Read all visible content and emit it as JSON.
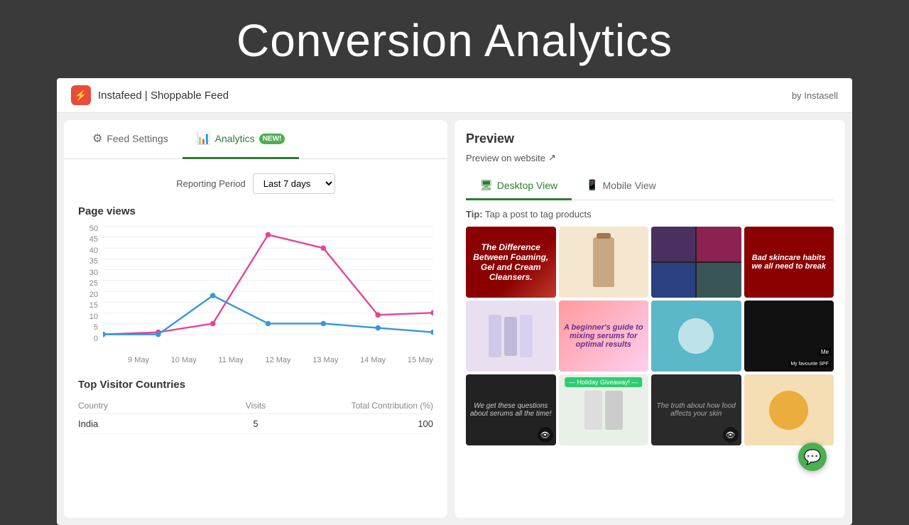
{
  "page": {
    "title": "Conversion Analytics",
    "app_name": "Instafeed | Shoppable Feed",
    "by": "by Instasell"
  },
  "tabs": [
    {
      "id": "feed-settings",
      "label": "Feed Settings",
      "icon": "⚙",
      "active": false
    },
    {
      "id": "analytics",
      "label": "Analytics",
      "icon": "📊",
      "active": true,
      "badge": "NEW!"
    }
  ],
  "reporting": {
    "label": "Reporting Period",
    "period": "Last 7 days"
  },
  "chart": {
    "title": "Page views",
    "y_labels": [
      "50",
      "45",
      "40",
      "35",
      "30",
      "25",
      "20",
      "15",
      "10",
      "5",
      "0"
    ],
    "x_labels": [
      "9 May",
      "10 May",
      "11 May",
      "12 May",
      "13 May",
      "14 May",
      "15 May"
    ],
    "pink_data": [
      0,
      1,
      5,
      46,
      40,
      9,
      10
    ],
    "blue_data": [
      0,
      0,
      18,
      5,
      5,
      3,
      1
    ]
  },
  "visitors": {
    "title": "Top Visitor Countries",
    "columns": [
      "Country",
      "Visits",
      "Total Contribution (%)"
    ],
    "rows": [
      {
        "country": "India",
        "visits": "5",
        "contribution": "100"
      }
    ]
  },
  "preview": {
    "title": "Preview",
    "link_label": "Preview on website",
    "tip": "Tip: Tap a post to tag products",
    "view_tabs": [
      {
        "id": "desktop",
        "label": "Desktop View",
        "icon": "🖥",
        "active": true
      },
      {
        "id": "mobile",
        "label": "Mobile View",
        "icon": "📱",
        "active": false
      }
    ]
  },
  "grid_items": [
    {
      "id": 1,
      "text": "The Difference Between Foaming, Gel and Cream Cleansers.",
      "type": "text-dark-red"
    },
    {
      "id": 2,
      "text": "",
      "type": "product-beige"
    },
    {
      "id": 3,
      "text": "",
      "type": "collage-dark"
    },
    {
      "id": 4,
      "text": "Bad skincare habits we all need to break",
      "type": "text-dark-red"
    },
    {
      "id": 5,
      "text": "",
      "type": "product-purple"
    },
    {
      "id": 6,
      "text": "A beginner's guide to mixing serums for optimal results",
      "type": "text-pink"
    },
    {
      "id": 7,
      "text": "",
      "type": "product-teal"
    },
    {
      "id": 8,
      "text": "",
      "type": "bw-couple",
      "labels": [
        "Me",
        "My favourite SPF"
      ]
    },
    {
      "id": 9,
      "text": "We get these questions about serums all the time!",
      "type": "text-dark",
      "hidden": true
    },
    {
      "id": 10,
      "text": "",
      "type": "product-white",
      "badge": "Holiday Giveaway!"
    },
    {
      "id": 11,
      "text": "The truth about how food affects your skin",
      "type": "text-dark",
      "hidden": true
    },
    {
      "id": 12,
      "text": "",
      "type": "product-orange"
    }
  ]
}
